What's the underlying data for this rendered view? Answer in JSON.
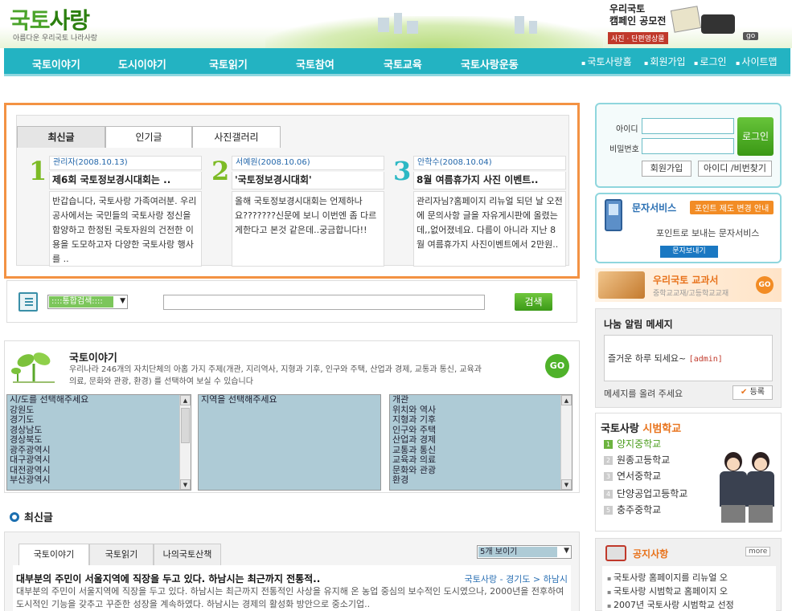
{
  "header": {
    "logo_title_a": "국토",
    "logo_title_b": "사랑",
    "logo_sub": "아름다운 우리국토 나라사랑",
    "campaign_line1": "우리국토",
    "campaign_line2": "캠페인 공모전",
    "campaign_badge": "사진 · 단편영상물",
    "campaign_go": "go"
  },
  "nav": {
    "items": [
      "국토이야기",
      "도시이야기",
      "국토읽기",
      "국토참여",
      "국토교육",
      "국토사랑운동"
    ],
    "util": [
      "국토사랑홈",
      "회원가입",
      "로그인",
      "사이트맵"
    ]
  },
  "recent": {
    "tabs": [
      "최신글",
      "인기글",
      "사진갤러리"
    ],
    "posts": [
      {
        "num": "1",
        "meta": "관리자(2008.10.13)",
        "title": "제6회 국토정보경시대회는 ..",
        "body": "반갑습니다, 국토사랑 가족여러분. 우리 공사에서는 국민들의 국토사랑 정신을 함양하고 한정된 국토자원의 건전한 이용을 도모하고자 다양한 국토사랑 행사를 .."
      },
      {
        "num": "2",
        "meta": "서예원(2008.10.06)",
        "title": "'국토정보경시대회'",
        "body": "올해 국토정보경시대회는 언제하나요???????신문에 보니 이번엔 좀 다르게한다고 본것 같은데..궁금합니다!!"
      },
      {
        "num": "3",
        "meta": "안학수(2008.10.04)",
        "title": "8월 여름휴가지 사진 이벤트..",
        "body": "관리자님?홈페이지 리뉴얼 되던 날 오전에 문의사항 글을 자유게시판에 올렸는데,,없어졌네요. 다름이 아니라 지난 8월 여름휴가지 사진이벤트에서 2만원.."
      }
    ]
  },
  "search": {
    "select_value": "::::통합검색::::",
    "input_value": "",
    "button": "검색"
  },
  "story": {
    "title": "국토이야기",
    "desc": "우리나라 246개의 자치단체의 아홉 가지 주제(개관, 지리역사, 지형과 기후, 인구와 주택, 산업과 경제, 교통과 통신, 교육과 의료, 문화와 관광, 환경) 를 선택하여 보실 수 있습니다",
    "go": "GO",
    "regions": [
      "시/도를 선택해주세요",
      "강원도",
      "경기도",
      "경상남도",
      "경상북도",
      "광주광역시",
      "대구광역시",
      "대전광역시",
      "부산광역시"
    ],
    "areas": [
      "지역을 선택해주세요"
    ],
    "topics": [
      "개관",
      "위치와 역사",
      "지형과 기후",
      "인구와 주택",
      "산업과 경제",
      "교통과 통신",
      "교육과 의료",
      "문화와 관광",
      "환경"
    ]
  },
  "latest": {
    "heading": "최신글",
    "tabs": [
      "국토이야기",
      "국토읽기",
      "나의국토산책"
    ],
    "dropdown": "5개 보이기",
    "headline": "대부분의 주민이 서울지역에 직장을 두고 있다. 하남시는 최근까지 전통적..",
    "source": "국토사랑 - 경기도 > 하남시",
    "excerpt": "대부분의 주민이 서울지역에 직장을 두고 있다. 하남시는 최근까지 전통적인 사상을 유지해 온 농업 중심의 보수적인 도시였으나, 2000년을 전후하여 도시적인 기능을 갖추고 꾸준한 성장을 계속하였다. 하남시는 경제의 활성화 방안으로 중소기업.."
  },
  "login": {
    "id_label": "아이디",
    "pw_label": "비밀번호",
    "button": "로그인",
    "join": "회원가입",
    "find": "아이디 /비번찾기"
  },
  "sms": {
    "title": "문자서비스",
    "badge": "포인트 제도 변경 안내",
    "desc": "포인트로 보내는 문자서비스",
    "send": "문자보내기"
  },
  "textbook": {
    "title": "우리국토 교과서",
    "sub": "중학교교재/고등학교교재",
    "go": "GO"
  },
  "message": {
    "title": "나눔 알림 메세지",
    "text": "즐거운 하루 되세요~ ",
    "author": "[admin]",
    "hint": "메세지를 올려 주세요",
    "register": "등록"
  },
  "school": {
    "title_a": "국토사랑 ",
    "title_b": "시범학교",
    "items": [
      "양지중학교",
      "원종고등학교",
      "연서중학교",
      "단양공업고등학교",
      "충주중학교"
    ]
  },
  "notice": {
    "title": "공지사항",
    "more": "more",
    "items": [
      "국토사랑 홈페이지를 리뉴얼 오",
      "국토사랑 시범학교 홈페이지 오",
      "2007년 국토사랑 시범학교 선정"
    ]
  }
}
